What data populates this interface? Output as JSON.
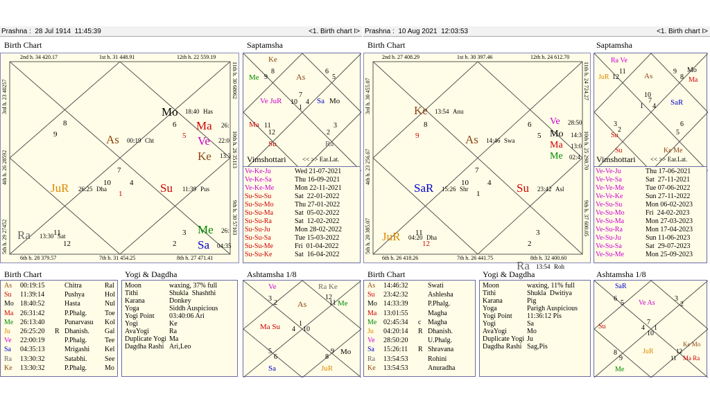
{
  "colors": {
    "panel_bg": "#fffde7",
    "border": "#6a6aa8",
    "red": "#cc0000",
    "magenta": "#cc00cc",
    "green": "#008800",
    "orange": "#dd8800",
    "blue": "#0000cc",
    "brown": "#8b4513",
    "gray": "#666666"
  },
  "left": {
    "prashna": "Prashna :  28 Jul 1914  11:45:39",
    "nav": "<1. Birth chart I>",
    "birth_chart_title": "Birth Chart",
    "saptamsha_title": "Saptamsha",
    "vimshottari_title": "Vimshottari",
    "vim_nav": "<< >> Ear.Lat.",
    "list_title": "Birth Chart",
    "yogi_title": "Yogi & Dagdha",
    "ashtamsha_title": "Ashtamsha 1/8",
    "edges": {
      "top1": "2nd h.  34  420.17",
      "top2": "1st h.  31  448.91",
      "top3": "12th h.  22  559.19",
      "bot1": "6th h.  28  379.57",
      "bot2": "7th h.  31  454.25",
      "bot3": "8th h.  27  471.41",
      "left1": "3rd h.  23  40257",
      "left2": "4th h.  26  28592",
      "left3": "5th h.  29  27452",
      "right1": "11th h.  30  68062",
      "right2": "10th h.  26  35113",
      "right3": "9th h.  30  57103"
    },
    "rasi": {
      "Mo": "Mo",
      "Mo_deg": "18:40",
      "Mo_nak": "Has",
      "six": "6",
      "five": "5",
      "Ma": "Ma",
      "Ma_deg": "26:",
      "Ve": "Ve",
      "Ve_deg": "22:0",
      "Ke": "Ke",
      "Ke_deg": "13:3",
      "eight": "8",
      "nine": "9",
      "As": "As",
      "As_deg": "00:19",
      "As_nak": "Cht",
      "seven": "7",
      "ten": "10",
      "four": "4",
      "one": "1",
      "JuR": "JuR",
      "JuR_deg": "26:25",
      "JuR_nak": "Dha",
      "Su": "Su",
      "Su_deg": "11:39",
      "Su_nak": "Pus",
      "Ra": "Ra",
      "Ra_deg": "13:30",
      "Ra_nak": "Sat",
      "eleven": "11",
      "twelve": "12",
      "three": "3",
      "two": "2",
      "Me": "Me",
      "Me_deg": "26:",
      "Sa": "Sa",
      "Sa_deg": "04:35"
    },
    "sapt": {
      "Ke": "Ke",
      "Me": "Me",
      "n9": "9",
      "n8": "8",
      "As": "As",
      "n6": "6",
      "n5": "5",
      "VeJuR": "Ve JuR",
      "n10": "10",
      "n7": "7",
      "n4": "4",
      "n1": "1",
      "Sa": "Sa",
      "Mo": "Mo",
      "Ma": "Ma",
      "n11": "11",
      "n12": "12",
      "n3": "3",
      "n2": "2",
      "Su": "Su",
      "Ra": "Ra"
    },
    "vim": [
      {
        "p": "Ve-Ke-Ju",
        "d": "Wed 21-07-2021",
        "c": "magenta"
      },
      {
        "p": "Ve-Ke-Sa",
        "d": "Thu 16-09-2021",
        "c": "magenta"
      },
      {
        "p": "Ve-Ke-Me",
        "d": "Mon 22-11-2021",
        "c": "magenta"
      },
      {
        "p": "Su-Su-Su",
        "d": "Sat  22-01-2022",
        "c": "red"
      },
      {
        "p": "Su-Su-Mo",
        "d": "Thu 27-01-2022",
        "c": "red"
      },
      {
        "p": "Su-Su-Ma",
        "d": "Sat  05-02-2022",
        "c": "red"
      },
      {
        "p": "Su-Su-Ra",
        "d": "Sat  12-02-2022",
        "c": "red"
      },
      {
        "p": "Su-Su-Ju",
        "d": "Mon 28-02-2022",
        "c": "red"
      },
      {
        "p": "Su-Su-Sa",
        "d": "Tue 15-03-2022",
        "c": "red"
      },
      {
        "p": "Su-Su-Me",
        "d": "Fri  01-04-2022",
        "c": "red"
      },
      {
        "p": "Su-Su-Ke",
        "d": "Sat  16-04-2022",
        "c": "red"
      }
    ],
    "planets": [
      {
        "pl": "As",
        "deg": "00:19:15",
        "r": "",
        "nak": "Chitra",
        "ex": "Ral"
      },
      {
        "pl": "Su",
        "deg": "11:39:14",
        "r": "",
        "nak": "Pushya",
        "ex": "Hol"
      },
      {
        "pl": "Mo",
        "deg": "18:40:52",
        "r": "",
        "nak": "Hasta",
        "ex": "Nul"
      },
      {
        "pl": "Ma",
        "deg": "26:31:42",
        "r": "",
        "nak": "P.Phalg.",
        "ex": "Toe"
      },
      {
        "pl": "Me",
        "deg": "26:13:40",
        "r": "",
        "nak": "Punarvasu",
        "ex": "Kol"
      },
      {
        "pl": "Ju",
        "deg": "26:25:20",
        "r": "R",
        "nak": "Dhanish.",
        "ex": "Gal"
      },
      {
        "pl": "Ve",
        "deg": "22:00:19",
        "r": "",
        "nak": "P.Phalg.",
        "ex": "Tee"
      },
      {
        "pl": "Sa",
        "deg": "04:35:13",
        "r": "",
        "nak": "Mrigashi",
        "ex": "Kel"
      },
      {
        "pl": "Ra",
        "deg": "13:30:32",
        "r": "",
        "nak": "Satabhi.",
        "ex": "See"
      },
      {
        "pl": "Ke",
        "deg": "13:30:32",
        "r": "",
        "nak": "P.Phalg.",
        "ex": "Mo"
      }
    ],
    "yogi": [
      {
        "k": "Moon",
        "v": "waxing, 37% full"
      },
      {
        "k": "Tithi",
        "v": "Shukla  Shashthi"
      },
      {
        "k": "Karana",
        "v": "Donkey"
      },
      {
        "k": "Yoga",
        "v": "Siddh Auspicious"
      },
      {
        "k": "Yogi Point",
        "v": "03:40:06 Ari"
      },
      {
        "k": "Yogi",
        "v": "Ke"
      },
      {
        "k": "AvaYogi",
        "v": "Ra"
      },
      {
        "k": "Duplicate Yogi",
        "v": "Ma"
      },
      {
        "k": "Dagdha Rashi",
        "v": "Ari,Leo"
      }
    ],
    "asht": {
      "Ve": "Ve",
      "RaKe": "Ra Ke",
      "n3": "3",
      "n2": "2",
      "As": "As",
      "n12": "12",
      "n11": "11",
      "Me": "Me",
      "MaSu": "Ma Su",
      "n4": "4",
      "n1": "1",
      "n10": "10",
      "Mo": "Mo",
      "n5": "5",
      "n6": "6",
      "n8": "8",
      "n9": "9",
      "Sa": "Sa",
      "JuR": "JuR"
    }
  },
  "right": {
    "prashna": "Prashna :  10 Aug 2021  12:03:53",
    "nav": "<1. Birth chart I>",
    "birth_chart_title": "Birth Chart",
    "saptamsha_title": "Saptamsha",
    "vimshottari_title": "Vimshottari",
    "vim_nav": "<< >> Ear.Lat.",
    "list_title": "Birth Chart",
    "yogi_title": "Yogi & Dagdha",
    "ashtamsha_title": "Ashtamsha 1/8",
    "edges": {
      "top1": "2nd h.  27  408.29",
      "top2": "1st h.  30  397.46",
      "top3": "12th h.  24  612.70",
      "bot1": "6th h.  26  418.26",
      "bot2": "7th h.  26  441.75",
      "bot3": "8th h.  32  400.60",
      "left1": "3rd h.  30  455.07",
      "left2": "4th h.  23  256.67",
      "left3": "5th h.  20  385.07",
      "right1": "11th h.  24  724.27",
      "right2": "10th h.  25  298.70",
      "right3": "9th h.  37  600.05"
    },
    "rasi": {
      "Ke": "Ke",
      "Ke_deg": "13:54",
      "Ke_nak": "Anu",
      "eight": "8",
      "nine": "9",
      "As": "As",
      "As_deg": "14:46",
      "As_nak": "Swa",
      "six": "6",
      "five": "5",
      "Ve": "Ve",
      "Ve_deg": "28:50",
      "Mo": "Mo",
      "Mo_deg": "14:3",
      "Ma": "Ma",
      "Ma_deg": "13:0",
      "Me": "Me",
      "Me_deg": "02:4",
      "seven": "7",
      "ten": "10",
      "four": "4",
      "one": "1",
      "SaR": "SaR",
      "SaR_deg": "15:26",
      "SaR_nak": "Shr",
      "Su": "Su",
      "Su_deg": "23:42",
      "Su_nak": "Asl",
      "JuR": "JuR",
      "JuR_deg": "04:20",
      "JuR_nak": "Dha",
      "eleven": "11",
      "twelve": "12",
      "three": "3",
      "two": "2",
      "Ra": "Ra",
      "Ra_deg": "13:54",
      "Ra_nak": "Roh"
    },
    "sapt": {
      "RaVe": "Ra Ve",
      "JuR": "JuR",
      "n12": "12",
      "n11": "11",
      "As": "As",
      "n9": "9",
      "n8": "8",
      "Mo": "Mo",
      "Ma": "Ma",
      "n10": "10",
      "n7": "7",
      "n1": "1",
      "n4": "4",
      "SaR": "SaR",
      "Su": "Su",
      "n2": "2",
      "n3": "3",
      "n5": "5",
      "n6": "6",
      "Su2": "Su",
      "KeMe": "Ke Me"
    },
    "vim": [
      {
        "p": "Ve-Ve-Ju",
        "d": "Thu 17-06-2021",
        "c": "magenta"
      },
      {
        "p": "Ve-Ve-Sa",
        "d": "Sat  27-11-2021",
        "c": "magenta"
      },
      {
        "p": "Ve-Ve-Me",
        "d": "Tue 07-06-2022",
        "c": "magenta"
      },
      {
        "p": "Ve-Ve-Ke",
        "d": "Sun 27-11-2022",
        "c": "magenta"
      },
      {
        "p": "Ve-Su-Su",
        "d": "Mon 06-02-2023",
        "c": "magenta"
      },
      {
        "p": "Ve-Su-Mo",
        "d": "Fri  24-02-2023",
        "c": "magenta"
      },
      {
        "p": "Ve-Su-Ma",
        "d": "Mon 27-03-2023",
        "c": "magenta"
      },
      {
        "p": "Ve-Su-Ra",
        "d": "Mon 17-04-2023",
        "c": "magenta"
      },
      {
        "p": "Ve-Su-Ju",
        "d": "Sun 11-06-2023",
        "c": "magenta"
      },
      {
        "p": "Ve-Su-Sa",
        "d": "Sat  29-07-2023",
        "c": "magenta"
      },
      {
        "p": "Ve-Su-Me",
        "d": "Mon 25-09-2023",
        "c": "magenta"
      }
    ],
    "planets": [
      {
        "pl": "As",
        "deg": "14:46:32",
        "r": "",
        "nak": "Swati"
      },
      {
        "pl": "Su",
        "deg": "23:42:32",
        "r": "",
        "nak": "Ashlesha"
      },
      {
        "pl": "Mo",
        "deg": "14:33:39",
        "r": "",
        "nak": "P.Phalg."
      },
      {
        "pl": "Ma",
        "deg": "13:01:55",
        "r": "",
        "nak": "Magha"
      },
      {
        "pl": "Me",
        "deg": "02:45:34",
        "r": "c",
        "nak": "Magha"
      },
      {
        "pl": "Ju",
        "deg": "04:20:14",
        "r": "R",
        "nak": "Dhanish."
      },
      {
        "pl": "Ve",
        "deg": "28:50:20",
        "r": "",
        "nak": "U.Phalg."
      },
      {
        "pl": "Sa",
        "deg": "15:26:11",
        "r": "R",
        "nak": "Shravana"
      },
      {
        "pl": "Ra",
        "deg": "13:54:53",
        "r": "",
        "nak": "Rohini"
      },
      {
        "pl": "Ke",
        "deg": "13:54:53",
        "r": "",
        "nak": "Anuradha"
      }
    ],
    "yogi": [
      {
        "k": "Moon",
        "v": "waxing, 11% full"
      },
      {
        "k": "Tithi",
        "v": "Shukla  Dwitiya"
      },
      {
        "k": "Karana",
        "v": "Pig"
      },
      {
        "k": "Yoga",
        "v": "Parigh Auspicious"
      },
      {
        "k": "Yogi Point",
        "v": "11:36:12 Pis"
      },
      {
        "k": "Yogi",
        "v": "Sa"
      },
      {
        "k": "AvaYogi",
        "v": "Mo"
      },
      {
        "k": "Duplicate Yogi",
        "v": "Ju"
      },
      {
        "k": "Dagdha Rashi",
        "v": "Sag,Pis"
      }
    ],
    "asht": {
      "SaR": "SaR",
      "n6": "6",
      "n5": "5",
      "VeAs": "Ve As",
      "n3": "3",
      "n2": "2",
      "Su": "Su",
      "n7": "7",
      "n4": "4",
      "n1": "1",
      "n10": "10",
      "n8": "8",
      "n9": "9",
      "JuR": "JuR",
      "KeMo": "Ke Mo",
      "n12": "12",
      "n11": "11",
      "MaRa": "Ma Ra",
      "Me": "Me"
    }
  }
}
